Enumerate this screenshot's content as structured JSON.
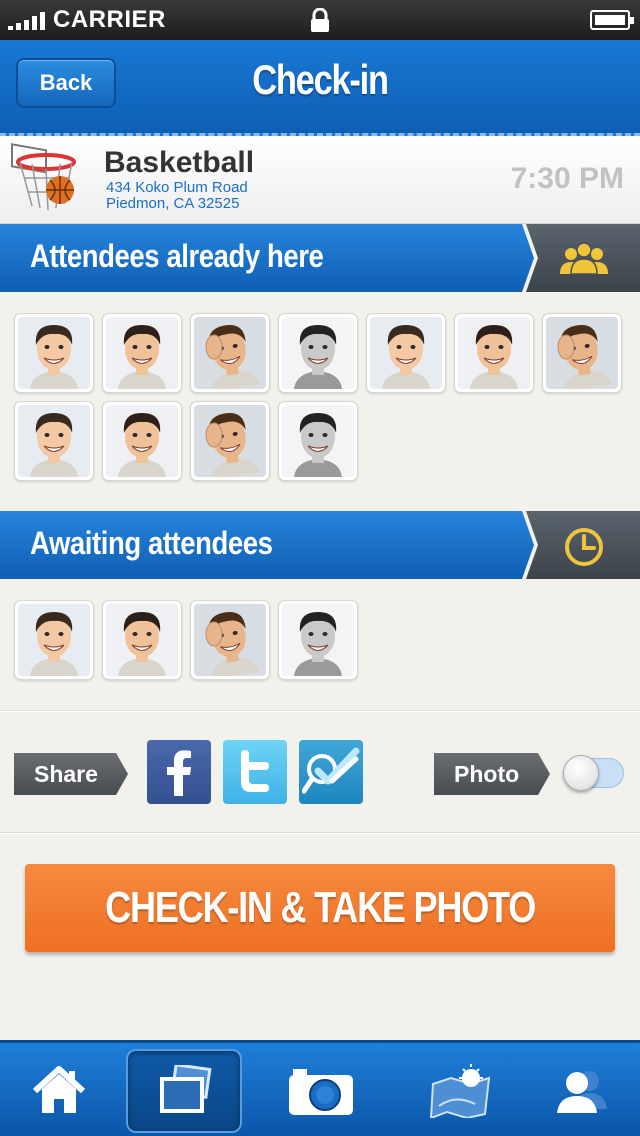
{
  "status_bar": {
    "carrier": "CARRIER"
  },
  "header": {
    "back_label": "Back",
    "title": "Check-in"
  },
  "event": {
    "name": "Basketball",
    "address_line1": "434 Koko Plum Road",
    "address_line2": "Piedmon, CA 32525",
    "time": "7:30 PM"
  },
  "sections": {
    "attendees_here": {
      "label": "Attendees already here",
      "icon": "group-icon",
      "count": 11
    },
    "awaiting": {
      "label": "Awaiting attendees",
      "icon": "clock-icon",
      "count": 4
    }
  },
  "share": {
    "label": "Share",
    "networks": [
      "facebook-icon",
      "twitter-icon",
      "foursquare-icon"
    ],
    "photo_label": "Photo",
    "photo_enabled": false
  },
  "cta": {
    "label": "CHECK-IN & TAKE PHOTO"
  },
  "tabbar": {
    "tabs": [
      "home-icon",
      "gallery-icon",
      "camera-icon",
      "map-icon",
      "profile-icon"
    ],
    "active_index": 1
  },
  "colors": {
    "brand_blue": "#1a78d4",
    "accent_orange": "#f27a2e",
    "section_icon_yellow": "#f0c53a"
  }
}
